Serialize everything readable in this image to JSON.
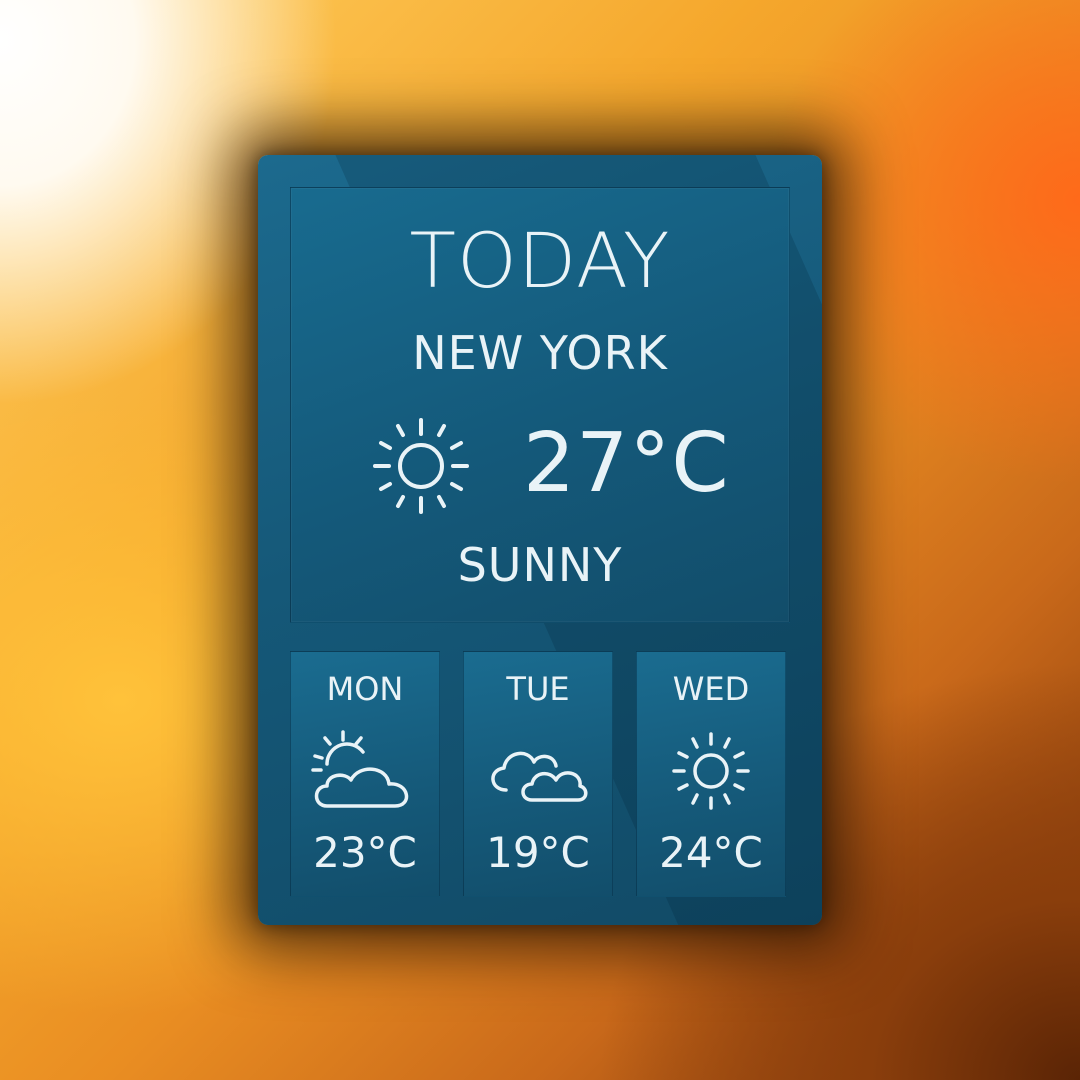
{
  "today": {
    "title": "TODAY",
    "city": "NEW YORK",
    "temperature": "27°C",
    "condition": "SUNNY",
    "icon": "sun-icon"
  },
  "forecast": [
    {
      "day": "MON",
      "temperature": "23°C",
      "icon": "partly-cloudy-icon"
    },
    {
      "day": "TUE",
      "temperature": "19°C",
      "icon": "cloudy-icon"
    },
    {
      "day": "WED",
      "temperature": "24°C",
      "icon": "sun-icon"
    }
  ],
  "colors": {
    "widget_background": "#155878",
    "text": "#e9f3f7",
    "backdrop_warm": "#f5a72c"
  }
}
